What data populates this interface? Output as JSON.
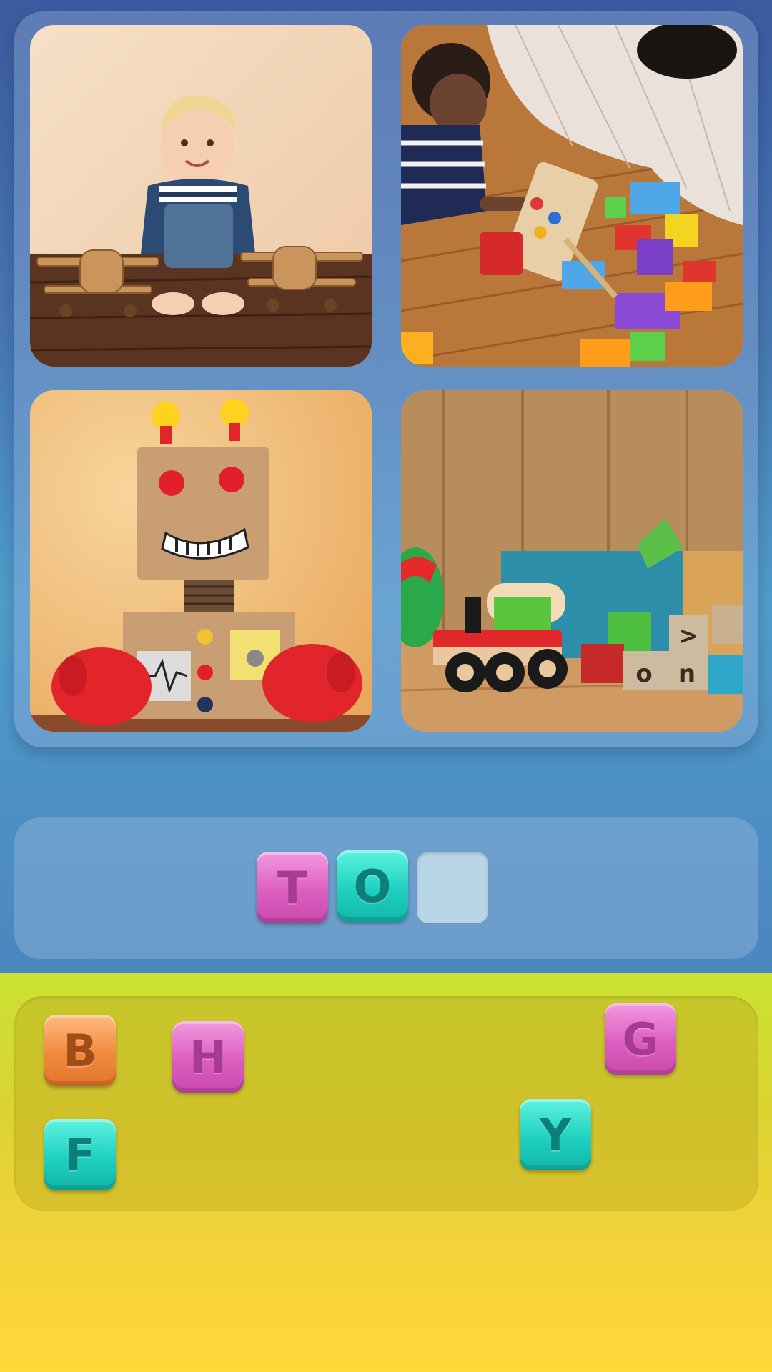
{
  "puzzle": {
    "photos": [
      {
        "id": "baby-with-wooden-planes"
      },
      {
        "id": "child-with-building-blocks"
      },
      {
        "id": "cardboard-robot"
      },
      {
        "id": "toy-train-and-blocks"
      }
    ],
    "answer_slots": [
      {
        "letter": "T",
        "color": "pink"
      },
      {
        "letter": "O",
        "color": "teal"
      },
      {
        "letter": "",
        "color": "empty"
      }
    ],
    "letter_bank": [
      {
        "letter": "B",
        "color": "orange"
      },
      {
        "letter": "H",
        "color": "pink"
      },
      {
        "letter": "G",
        "color": "pink"
      },
      {
        "letter": "Y",
        "color": "teal"
      },
      {
        "letter": "F",
        "color": "teal"
      }
    ]
  },
  "colors": {
    "pink": "#dc5ebf",
    "teal": "#1fd0c0",
    "orange": "#f28a3e",
    "top_background": "#4677b2",
    "bottom_background": "#f4d33a"
  }
}
